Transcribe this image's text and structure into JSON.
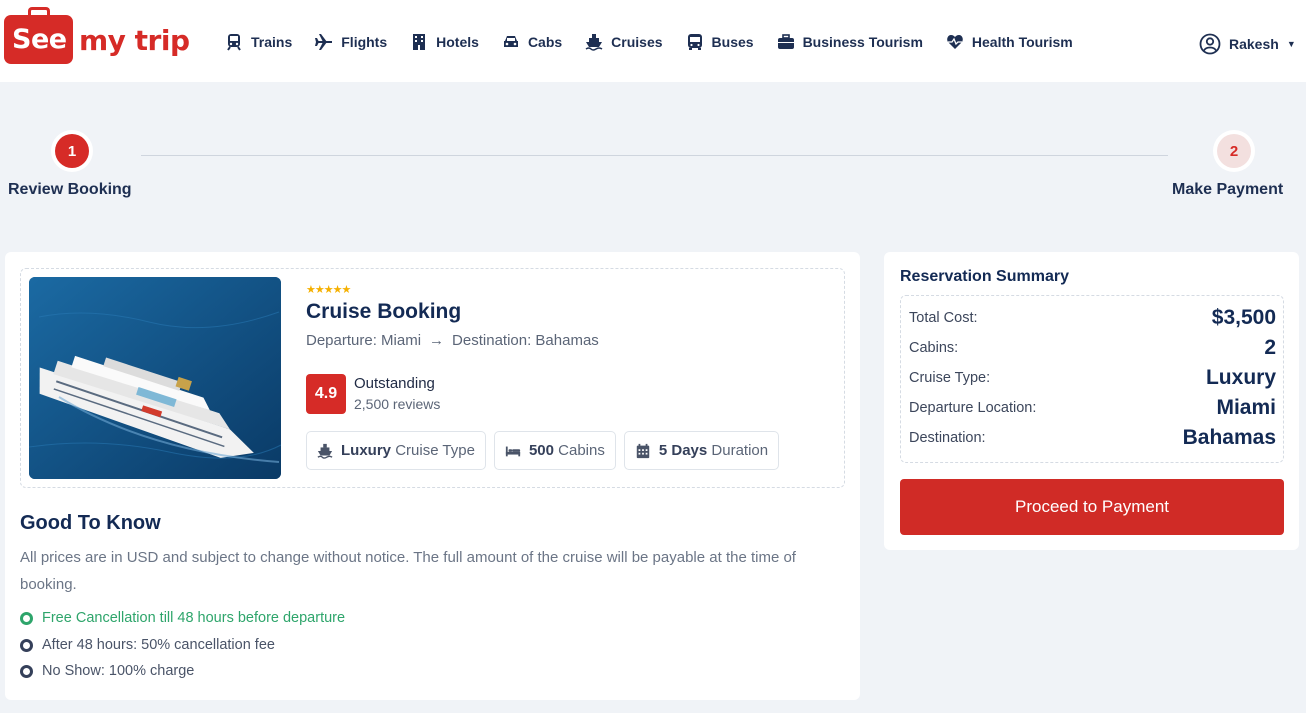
{
  "brand": {
    "see": "See",
    "rest": "my trip",
    "accent_color": "#d62b27"
  },
  "nav": {
    "items": [
      {
        "label": "Trains",
        "icon": "train-icon"
      },
      {
        "label": "Flights",
        "icon": "plane-icon"
      },
      {
        "label": "Hotels",
        "icon": "hotel-icon"
      },
      {
        "label": "Cabs",
        "icon": "car-icon"
      },
      {
        "label": "Cruises",
        "icon": "ship-icon"
      },
      {
        "label": "Buses",
        "icon": "bus-icon"
      },
      {
        "label": "Business Tourism",
        "icon": "briefcase-icon"
      },
      {
        "label": "Health Tourism",
        "icon": "heart-pulse-icon"
      }
    ],
    "user": "Rakesh"
  },
  "stepper": {
    "step1": {
      "number": "1",
      "label": "Review Booking"
    },
    "step2": {
      "number": "2",
      "label": "Make Payment"
    }
  },
  "booking": {
    "stars": "★★★★★",
    "title": "Cruise Booking",
    "departure": "Departure: Miami",
    "arrow": "→",
    "destination": "Destination: Bahamas",
    "rating": "4.9",
    "rating_label": "Outstanding",
    "reviews": "2,500 reviews",
    "chips": [
      {
        "bold": "Luxury",
        "text": "Cruise Type",
        "icon": "ship-icon"
      },
      {
        "bold": "500",
        "text": "Cabins",
        "icon": "bed-icon"
      },
      {
        "bold": "5 Days",
        "text": "Duration",
        "icon": "calendar-icon"
      }
    ]
  },
  "good_to_know": {
    "title": "Good To Know",
    "text": "All prices are in USD and subject to change without notice. The full amount of the cruise will be payable at the time of booking.",
    "policies": [
      {
        "text": "Free Cancellation till 48 hours before departure",
        "status": "positive"
      },
      {
        "text": "After 48 hours: 50% cancellation fee",
        "status": "neutral"
      },
      {
        "text": "No Show: 100% charge",
        "status": "neutral"
      }
    ]
  },
  "summary": {
    "title": "Reservation Summary",
    "rows": [
      {
        "label": "Total Cost:",
        "value": "$3,500"
      },
      {
        "label": "Cabins:",
        "value": "2"
      },
      {
        "label": "Cruise Type:",
        "value": "Luxury"
      },
      {
        "label": "Departure Location:",
        "value": "Miami"
      },
      {
        "label": "Destination:",
        "value": "Bahamas"
      }
    ],
    "button": "Proceed to Payment"
  }
}
